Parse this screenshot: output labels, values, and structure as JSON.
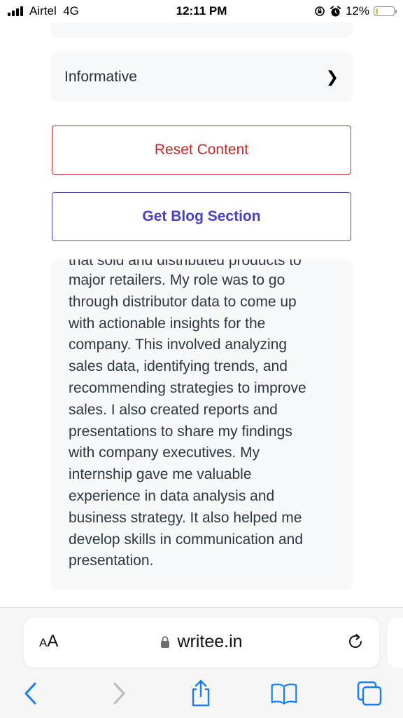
{
  "status": {
    "carrier": "Airtel",
    "network": "4G",
    "time": "12:11 PM",
    "battery_pct": "12%",
    "battery_level": 0.12,
    "battery_color": "#f5c518"
  },
  "form": {
    "tone_label": "Informative",
    "tone_icon": "chevron-right-icon",
    "reset_label": "Reset Content",
    "get_blog_label": "Get Blog Section",
    "reset_color": "#c62828",
    "blog_color": "#4740c8"
  },
  "blog": {
    "cut_line": "that sold and distributed products to",
    "text": "major retailers. My role was to go\nthrough distributor data to come up\nwith actionable insights for the\ncompany. This involved analyzing\nsales data, identifying trends, and\nrecommending strategies to improve\nsales. I also created reports and\npresentations to share my findings\nwith company executives. My\ninternship gave me valuable\nexperience in data analysis and\nbusiness strategy. It also helped me\ndevelop skills in communication and\npresentation."
  },
  "browser": {
    "text_size_label_small": "A",
    "text_size_label_large": "A",
    "url": "writee.in",
    "accent_color": "#1a7cf5",
    "toolbar_icons": [
      "back-icon",
      "forward-icon",
      "share-icon",
      "bookmarks-icon",
      "tabs-icon"
    ]
  }
}
